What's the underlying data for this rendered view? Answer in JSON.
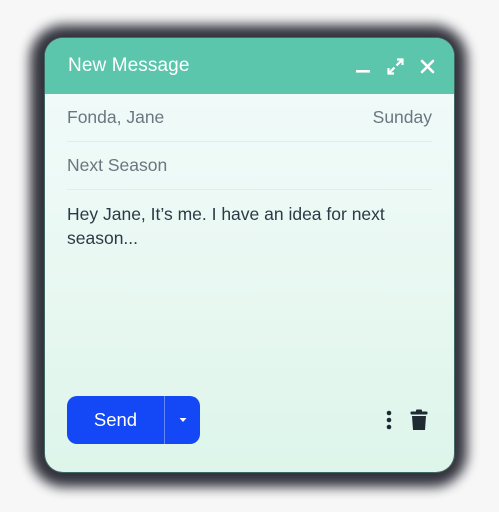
{
  "window": {
    "title": "New Message",
    "icons": [
      "minimize-icon",
      "expand-icon",
      "close-icon"
    ]
  },
  "recipient": {
    "to": "Fonda, Jane",
    "date": "Sunday"
  },
  "subject": "Next Season",
  "message_body": "Hey Jane, It’s me. I have an idea for next season...",
  "footer": {
    "send_label": "Send",
    "icons": [
      "caret-down-icon",
      "more-vertical-icon",
      "trash-icon"
    ]
  },
  "colors": {
    "header": "#5cc6ad",
    "send_button": "#1447f5",
    "body_text": "#2d3a45",
    "muted_text": "#6a7680",
    "trash_icon": "#1f2a33"
  }
}
